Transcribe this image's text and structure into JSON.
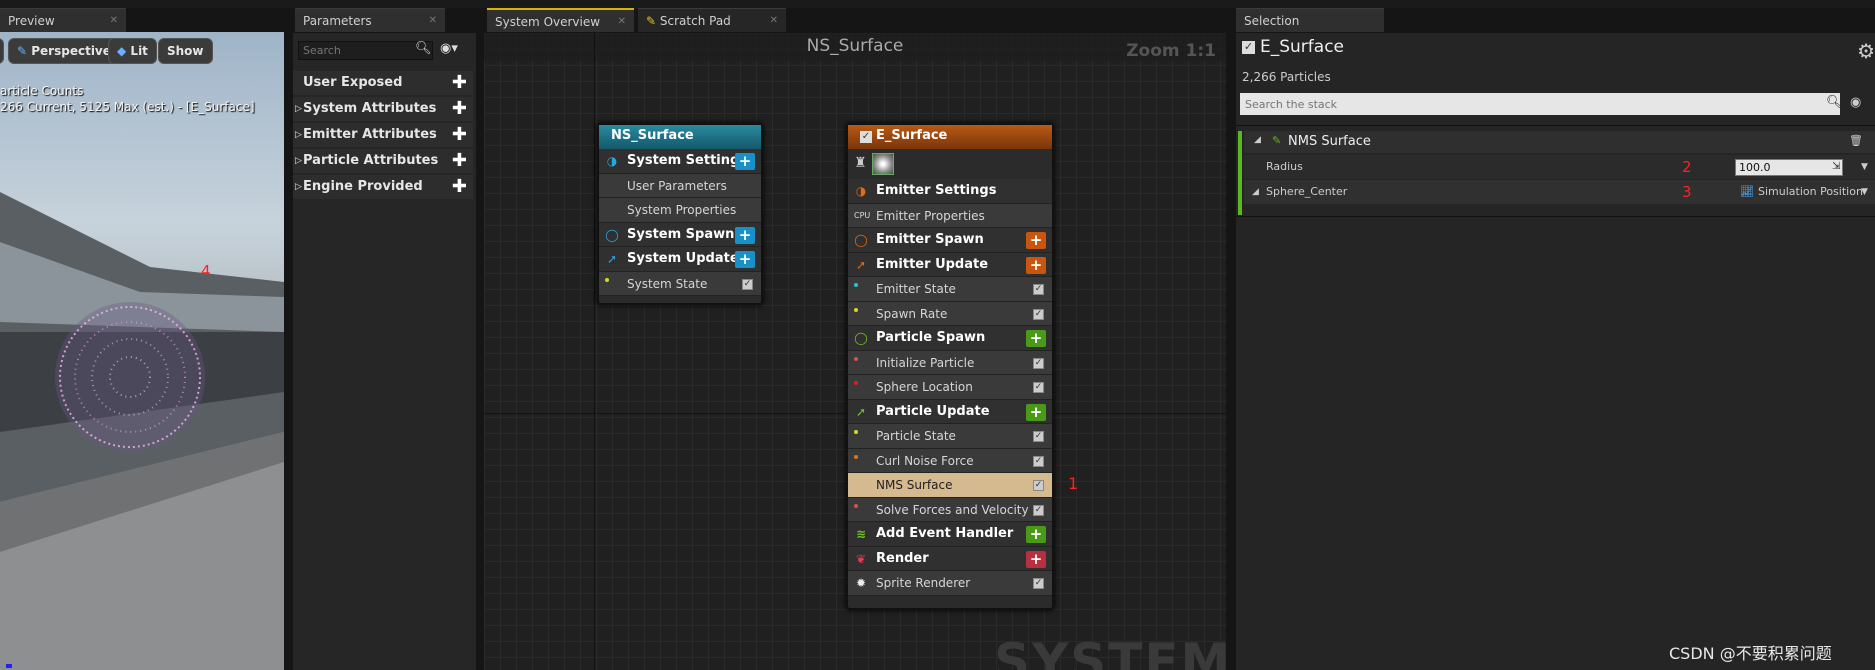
{
  "tabs": {
    "preview": "Preview",
    "parameters": "Parameters",
    "system_overview": "System Overview",
    "scratch_pad": "Scratch Pad",
    "selection": "Selection"
  },
  "preview": {
    "perspective": "Perspective",
    "lit": "Lit",
    "show": "Show",
    "counts_title": "article Counts",
    "counts_detail": "266 Current, 5125 Max (est.) - [E_Surface]",
    "marker": "4"
  },
  "parameters": {
    "search_placeholder": "Search",
    "rows": [
      "User Exposed",
      "System Attributes",
      "Emitter Attributes",
      "Particle Attributes",
      "Engine Provided"
    ]
  },
  "graph": {
    "title": "NS_Surface",
    "zoom": "Zoom 1:1",
    "watermark": "SYSTEM",
    "marker": "1",
    "system_node": {
      "title": "NS_Surface",
      "rows": [
        "System Settings",
        "User Parameters",
        "System Properties",
        "System Spawn",
        "System Update",
        "System State"
      ]
    },
    "emitter_node": {
      "title": "E_Surface",
      "rows": [
        "Emitter Settings",
        "Emitter Properties",
        "Emitter Spawn",
        "Emitter Update",
        "Emitter State",
        "Spawn Rate",
        "Particle Spawn",
        "Initialize Particle",
        "Sphere Location",
        "Particle Update",
        "Particle State",
        "Curl Noise Force",
        "NMS Surface",
        "Solve Forces and Velocity",
        "Add Event Handler",
        "Render",
        "Sprite Renderer"
      ]
    }
  },
  "selection": {
    "title": "E_Surface",
    "particles": "2,266 Particles",
    "search_placeholder": "Search the stack",
    "module": "NMS Surface",
    "radius_label": "Radius",
    "radius_value": "100.0",
    "center_label": "Sphere_Center",
    "center_value": "Simulation Position",
    "marker_2": "2",
    "marker_3": "3"
  },
  "watermark": "CSDN @不要积累问题"
}
